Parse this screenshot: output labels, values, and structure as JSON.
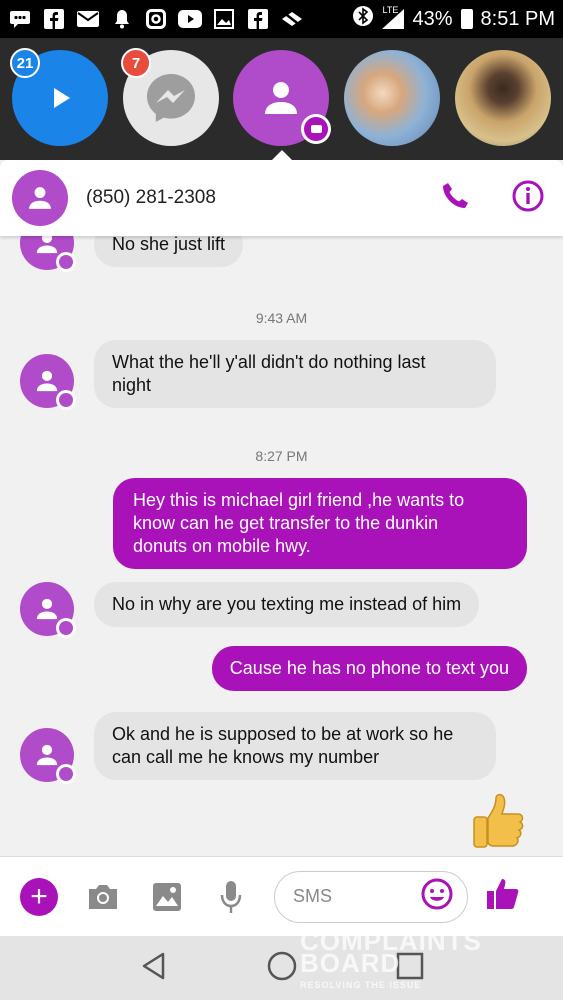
{
  "status_bar": {
    "battery": "43%",
    "time": "8:51 PM",
    "network": "LTE",
    "icons": [
      "chat-icon",
      "facebook-icon",
      "mail-icon",
      "notification-bell-icon",
      "instagram-icon",
      "youtube-icon",
      "gallery-icon",
      "facebook-icon",
      "mute-icon",
      "bluetooth-icon",
      "signal-icon",
      "battery-icon"
    ]
  },
  "chat_heads": [
    {
      "badge": "21",
      "type": "video-play",
      "color": "#1a84e8",
      "badge_color": "#1a84e8"
    },
    {
      "badge": "7",
      "type": "messenger",
      "color": "#e7e7e7",
      "badge_color": "#e74c3c"
    },
    {
      "badge": "",
      "type": "contact-active",
      "color": "#b04cc9"
    },
    {
      "badge": "",
      "type": "photo-contact",
      "color": "#9bb8d6"
    },
    {
      "badge": "",
      "type": "photo-contact",
      "color": "#c9a46a"
    }
  ],
  "conversation": {
    "contact": "(850) 281-2308"
  },
  "messages": [
    {
      "from": "them",
      "text": "No she just lift"
    },
    {
      "timestamp": "9:43 AM"
    },
    {
      "from": "them",
      "text_lines": [
        "What the he'll y'all didn't do nothing last",
        "night"
      ]
    },
    {
      "timestamp": "8:27 PM"
    },
    {
      "from": "me",
      "text_lines": [
        "Hey this is michael girl friend ,he wants to",
        "know can he get transfer to the dunkin",
        "donuts on mobile hwy."
      ]
    },
    {
      "from": "them",
      "text": "No in why are you texting me instead of him"
    },
    {
      "from": "me",
      "text": "Cause he has no phone to text you"
    },
    {
      "from": "them",
      "text_lines": [
        "Ok and he is supposed to be at work so he",
        "can call me he knows my number"
      ]
    }
  ],
  "composer": {
    "placeholder": "SMS",
    "accent": "#a812b8"
  },
  "watermark": {
    "line1": "COMPLAINTS",
    "line2": "BOARD",
    "tagline": "RESOLVING THE ISSUE"
  },
  "colors": {
    "accent": "#a812b8",
    "avatar": "#b04cc9",
    "incoming_bubble": "#e4e4e4"
  }
}
